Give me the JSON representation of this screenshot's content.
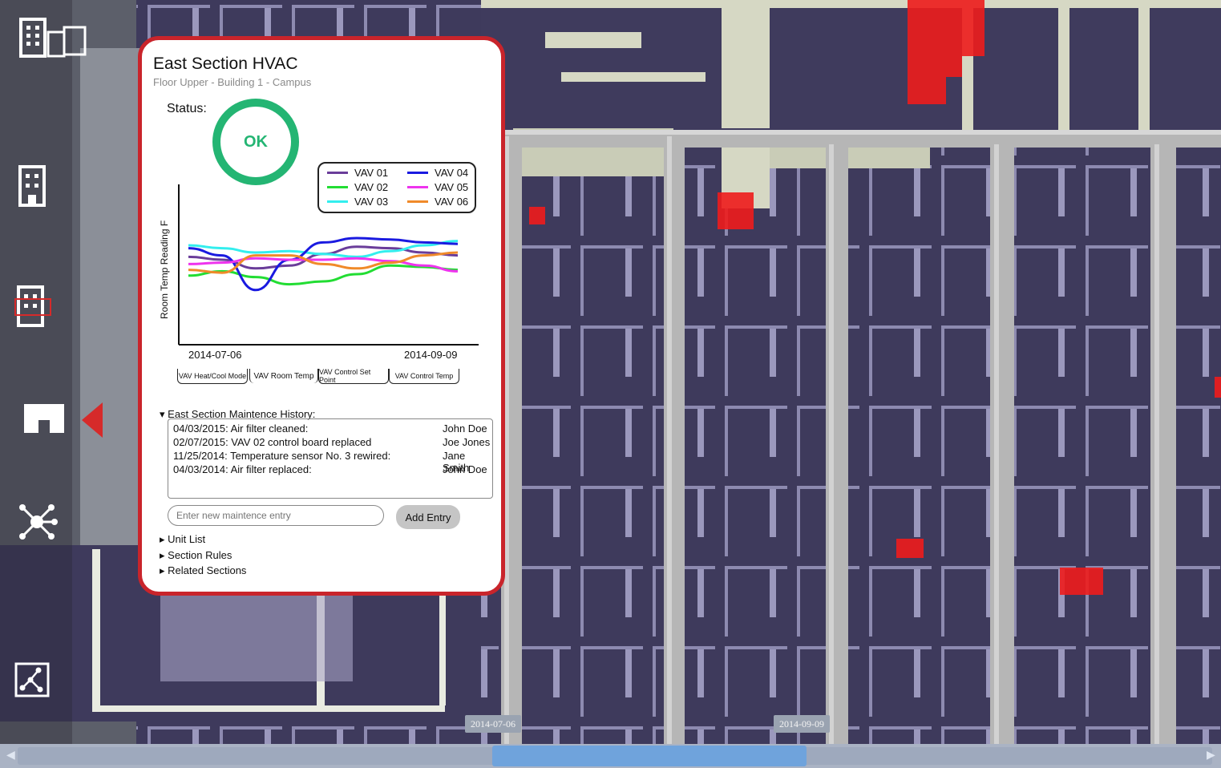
{
  "panel": {
    "title": "East Section HVAC",
    "subtitle": "Floor Upper - Building 1 - Campus",
    "status_label": "Status:",
    "status_value": "OK",
    "status_color": "#24b573",
    "border_color": "#c9242b"
  },
  "chart_data": {
    "type": "line",
    "ylabel": "Room Temp Reading F",
    "x": [
      "2014-07-06",
      "2014-09-09"
    ],
    "xticks": [
      "2014-07-06",
      "2014-09-09"
    ],
    "series": [
      {
        "name": "VAV 01",
        "color": "#6a3d9a",
        "values": [
          3.2,
          3.0,
          2.4,
          2.6,
          3.4,
          3.9,
          3.8,
          3.5,
          3.3
        ]
      },
      {
        "name": "VAV 02",
        "color": "#22dd33",
        "values": [
          1.9,
          2.2,
          1.8,
          1.3,
          1.5,
          2.0,
          2.6,
          2.5,
          2.3
        ]
      },
      {
        "name": "VAV 03",
        "color": "#33eeee",
        "values": [
          4.0,
          3.8,
          3.5,
          3.6,
          3.4,
          3.2,
          3.6,
          4.0,
          4.3
        ]
      },
      {
        "name": "VAV 04",
        "color": "#1a1ae0",
        "values": [
          3.8,
          3.3,
          0.9,
          3.0,
          4.2,
          4.5,
          4.4,
          4.2,
          4.1
        ]
      },
      {
        "name": "VAV 05",
        "color": "#ee33ee",
        "values": [
          2.7,
          2.8,
          3.1,
          3.0,
          3.0,
          3.1,
          2.9,
          2.6,
          2.2
        ]
      },
      {
        "name": "VAV 06",
        "color": "#f08a2a",
        "values": [
          2.3,
          2.1,
          3.3,
          3.3,
          2.7,
          2.4,
          2.8,
          3.3,
          3.5
        ]
      }
    ]
  },
  "tabs": [
    "VAV Heat/Cool Mode",
    "VAV Room Temp",
    "VAV Control Set Point",
    "VAV Control Temp"
  ],
  "history": {
    "heading": "East Section Maintence History:",
    "rows": [
      {
        "entry": "04/03/2015: Air filter cleaned:",
        "who": "John Doe"
      },
      {
        "entry": "02/07/2015: VAV  02 control board replaced",
        "who": "Joe Jones"
      },
      {
        "entry": "11/25/2014: Temperature sensor No. 3 rewired:",
        "who": "Jane Smith"
      },
      {
        "entry": "04/03/2014: Air filter replaced:",
        "who": "John Doe"
      }
    ],
    "input_placeholder": "Enter new maintence entry",
    "add_label": "Add Entry"
  },
  "sections": [
    "Unit List",
    "Section Rules",
    "Related Sections"
  ],
  "timeline": {
    "start_label": "2014-07-06",
    "end_label": "2014-09-09"
  },
  "sidebar_icons": [
    "campus-icon",
    "building-icon",
    "floor-icon",
    "floorplan-icon",
    "network-icon",
    "connections-icon"
  ]
}
